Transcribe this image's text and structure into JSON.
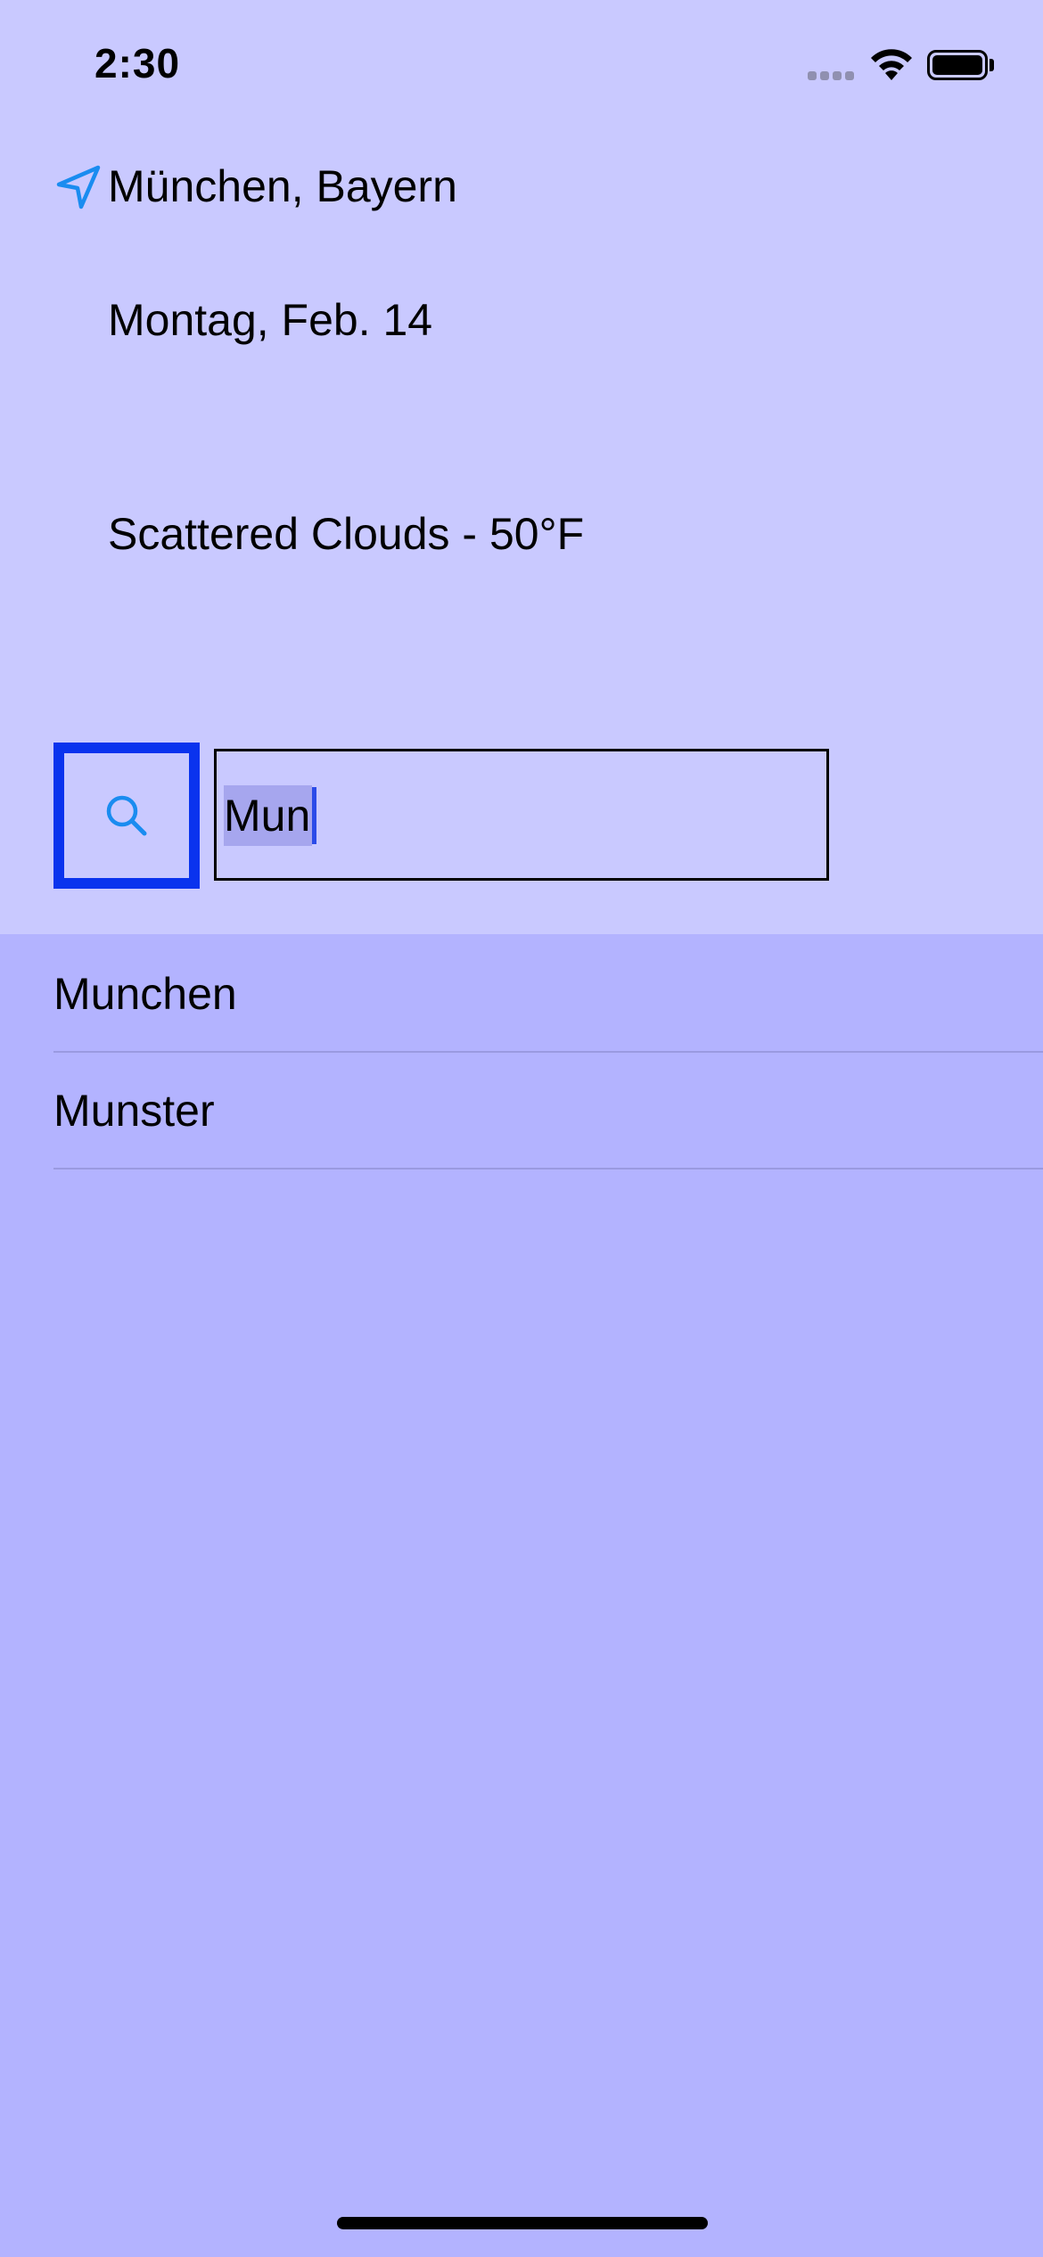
{
  "status_bar": {
    "time": "2:30",
    "signal_icon": "cellular-signal-icon",
    "wifi_icon": "wifi-icon",
    "battery_icon": "battery-icon"
  },
  "header": {
    "location_icon": "location-arrow-icon",
    "location": "München, Bayern",
    "date": "Montag, Feb. 14",
    "weather": "Scattered Clouds - 50°F"
  },
  "search": {
    "button_icon": "search-icon",
    "query": "Mun"
  },
  "results": [
    {
      "label": "Munchen"
    },
    {
      "label": "Munster"
    }
  ],
  "colors": {
    "top_background": "#c9c9ff",
    "list_background": "#b3b3ff",
    "accent": "#0a33ee",
    "icon_blue": "#1a8cf0"
  }
}
